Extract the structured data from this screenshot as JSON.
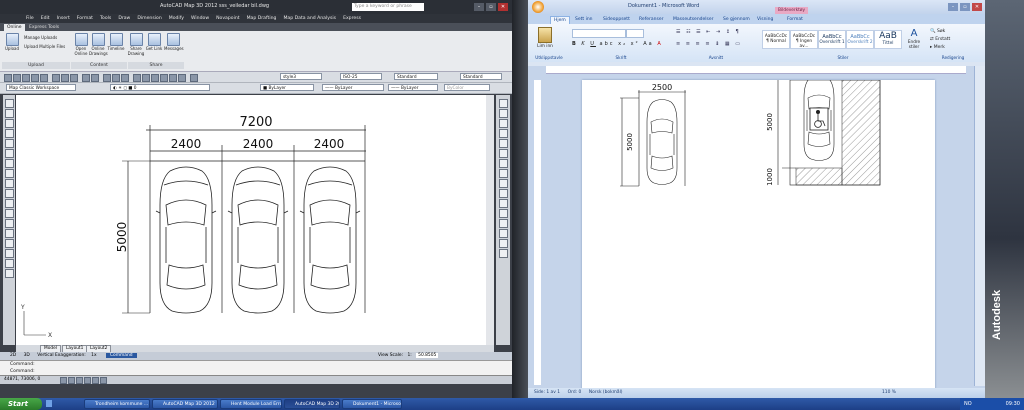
{
  "autocad": {
    "title": "AutoCAD Map 3D 2012    sss_veiledar bil.dwg",
    "search_placeholder": "Type a keyword or phrase",
    "menu": [
      "File",
      "Edit",
      "Insert",
      "Format",
      "Tools",
      "Draw",
      "Dimension",
      "Modify",
      "Window",
      "Novapoint",
      "Map Drafting",
      "Map Data and Analysis",
      "Express"
    ],
    "ribbon_tabs": [
      "Online",
      "Express Tools"
    ],
    "ribbon_buttons": [
      "Upload",
      "Open Online",
      "Online Drawings",
      "Timeline",
      "Share Drawing",
      "Get Link",
      "Messages"
    ],
    "ribbon_small": [
      "Manage Uploads",
      "Upload Multiple Files"
    ],
    "ribbon_groups": [
      "Upload",
      "Content",
      "Share"
    ],
    "toolbar_combos": [
      "style3",
      "ISO-25",
      "Standard",
      "Standard"
    ],
    "workspace": "Map Classic Workspace",
    "layer": "0",
    "props": [
      "ByLayer",
      "ByLayer",
      "ByLayer",
      "ByColor"
    ],
    "drawing": {
      "overall": "7200",
      "bays": [
        "2400",
        "2400",
        "2400"
      ],
      "height": "5000"
    },
    "layout_tabs": [
      "Model",
      "Layout1",
      "Layout2"
    ],
    "status1": [
      "2D",
      "3D",
      "Vertical Exaggeration:",
      "1x",
      "Command",
      "View Scale:",
      "1:",
      "50.8505"
    ],
    "cmd_lines": [
      "Command:",
      "Command:"
    ],
    "coords": "44871, 73006, 0"
  },
  "word": {
    "title": "Dokument1 - Microsoft Word",
    "context_tab": "Bildeverktøy",
    "tabs": [
      "Hjem",
      "Sett inn",
      "Sideoppsett",
      "Referanser",
      "Masseutsendelser",
      "Se gjennom",
      "Visning",
      "Format"
    ],
    "groups": [
      "Utklippstavle",
      "Skrift",
      "Avsnitt",
      "Stiler",
      "Redigering"
    ],
    "styles": [
      "AaBbCcDc",
      "AaBbCcDc",
      "AaBbCc",
      "AaBbCc",
      "AaB"
    ],
    "style_names": [
      "¶ Normal",
      "¶ Ingen av...",
      "Overskrift 1",
      "Overskrift 2",
      "Tittel"
    ],
    "edit_buttons": [
      "Søk",
      "Erstatt",
      "Merk"
    ],
    "paste": "Lim inn",
    "change_styles": "Endre stiler",
    "drawing": {
      "car_width": "2500",
      "car_height": "5000",
      "hc_height": "5000",
      "hc_extra": "1000"
    },
    "status": [
      "Side: 1 av 1",
      "Ord: 0",
      "Norsk (bokmål)"
    ],
    "zoom": "110 %"
  },
  "desktop": {
    "logo": "Autodesk"
  },
  "taskbar": {
    "start": "Start",
    "tasks": [
      "Trondheim kommune ...",
      "AutoCAD Map 3D 2012",
      "Hent Module Load Error",
      "AutoCAD Map 3D 201...",
      "Dokument1 - Microsof..."
    ],
    "lang": "NO",
    "time": "09:30"
  },
  "colors": {
    "word_blue": "#c5d4ea",
    "autocad_dark": "#3c4048",
    "taskbar": "#2f5aa8",
    "hatch": "#555555"
  }
}
